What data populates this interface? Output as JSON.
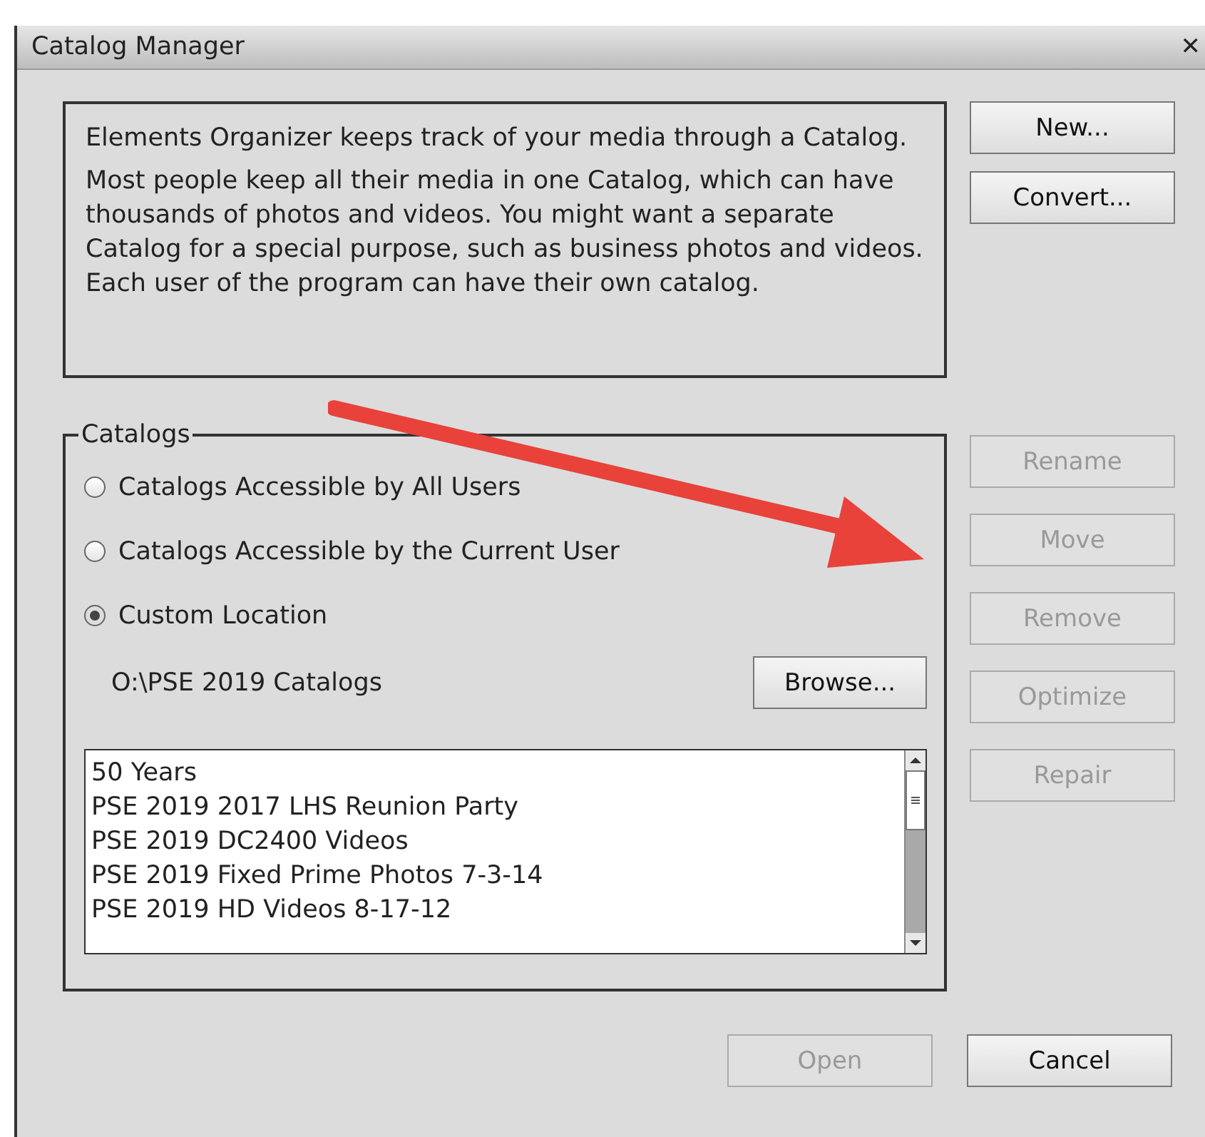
{
  "window": {
    "title": "Catalog Manager",
    "close": "✕"
  },
  "intro": [
    "Elements Organizer keeps track of your media through a Catalog.",
    "Most people keep all their media in one Catalog, which can have thousands of photos and videos. You might want a separate Catalog for a special purpose, such as business photos and videos. Each user of the program can have their own catalog."
  ],
  "top_buttons": [
    {
      "label": "New...",
      "disabled": false
    },
    {
      "label": "Convert...",
      "disabled": false
    }
  ],
  "catalogs": {
    "title": "Catalogs",
    "options": [
      {
        "label": "Catalogs Accessible by All Users",
        "selected": false
      },
      {
        "label": "Catalogs Accessible by the Current User",
        "selected": false
      },
      {
        "label": "Custom Location",
        "selected": true
      }
    ],
    "path": "O:\\PSE 2019 Catalogs",
    "browse": {
      "label": "Browse...",
      "disabled": false
    },
    "items": [
      "50 Years",
      "PSE 2019 2017 LHS Reunion Party",
      "PSE 2019 DC2400 Videos",
      "PSE 2019 Fixed Prime Photos 7-3-14",
      "PSE 2019 HD Videos 8-17-12"
    ]
  },
  "side_buttons": [
    {
      "label": "Rename",
      "disabled": true
    },
    {
      "label": "Move",
      "disabled": true
    },
    {
      "label": "Remove",
      "disabled": true
    },
    {
      "label": "Optimize",
      "disabled": true
    },
    {
      "label": "Repair",
      "disabled": true
    }
  ],
  "bottom_buttons": [
    {
      "label": "Open",
      "disabled": true
    },
    {
      "label": "Cancel",
      "disabled": false
    }
  ]
}
